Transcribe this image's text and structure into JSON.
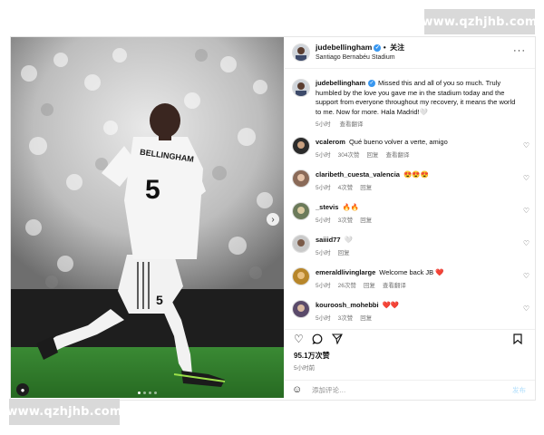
{
  "watermark": {
    "top": "www.qzhjhb.com",
    "bottom": "www.qzhjhb.com"
  },
  "photo": {
    "jersey_name": "BELLINGHAM",
    "jersey_number": "5",
    "short_number": "5"
  },
  "header": {
    "username": "judebellingham",
    "verified_mark": "✓",
    "follow_dot": "•",
    "follow_label": "关注",
    "location": "Santiago Bernabéu Stadium",
    "more_icon": "···"
  },
  "caption": {
    "username": "judebellingham",
    "verified_mark": "✓",
    "text": "Missed this and all of you so much. Truly humbled by the love you gave me in the stadium today and the support from everyone throughout my recovery, it means the world to me. Now for more. Hala Madrid!🤍",
    "time": "5小时",
    "translate": "查看翻译"
  },
  "comments": [
    {
      "username": "vcalerom",
      "text": "Qué bueno volver a verte, amigo",
      "time": "5小时",
      "likes": "304次赞",
      "reply": "回复",
      "translate": "查看翻译"
    },
    {
      "username": "claribeth_cuesta_valencia",
      "text": "😍😍😍",
      "time": "5小时",
      "likes": "4次赞",
      "reply": "回复",
      "translate": ""
    },
    {
      "username": "_stevis",
      "text": "🔥🔥",
      "time": "5小时",
      "likes": "3次赞",
      "reply": "回复",
      "translate": ""
    },
    {
      "username": "saiiid77",
      "text": "🤍",
      "time": "5小时",
      "likes": "",
      "reply": "回复",
      "translate": ""
    },
    {
      "username": "emeraldlivinglarge",
      "text": "Welcome back JB ❤️",
      "time": "5小时",
      "likes": "26次赞",
      "reply": "回复",
      "translate": "查看翻译"
    },
    {
      "username": "kouroosh_mohebbi",
      "text": "❤️❤️",
      "time": "5小时",
      "likes": "3次赞",
      "reply": "回复",
      "translate": ""
    }
  ],
  "actions": {
    "like_icon": "heart-icon",
    "comment_icon": "comment-icon",
    "share_icon": "send-icon",
    "save_icon": "bookmark-icon"
  },
  "stats": {
    "likes": "95.1万次赞",
    "ago": "5小时前"
  },
  "add_comment": {
    "placeholder": "添加评论…",
    "post_label": "发布"
  },
  "colors": {
    "verified": "#3897f0",
    "pitch": "#2f7a2a",
    "kit": "#f2f2f2"
  }
}
